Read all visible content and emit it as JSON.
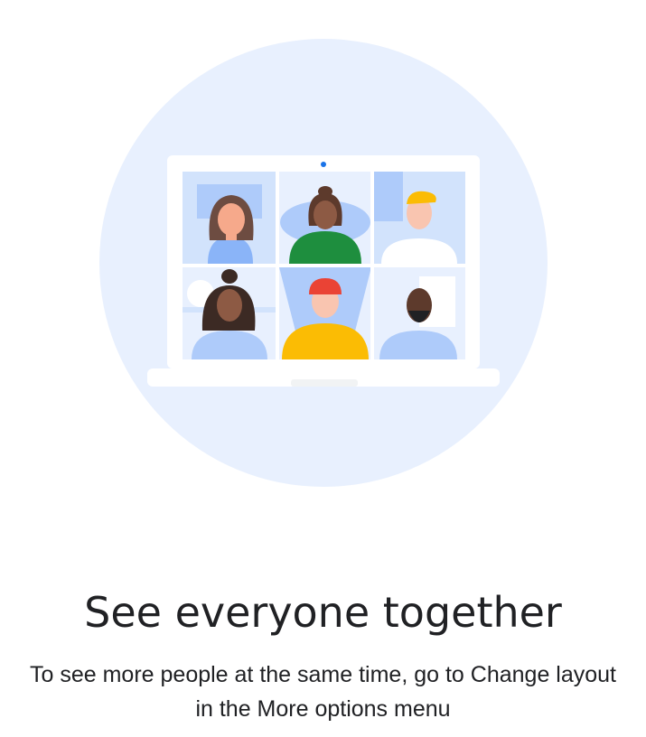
{
  "promo": {
    "title": "See everyone together",
    "description": "To see more people at the same time, go to Change layout in the More options menu"
  },
  "illustration": {
    "icon": "video-call-grid-illustration",
    "participants": [
      "participant-1",
      "participant-2",
      "participant-3",
      "participant-4",
      "participant-5",
      "participant-6"
    ]
  },
  "colors": {
    "circle_bg": "#e8f0fe",
    "tile_blue": "#aecbfa",
    "text": "#202124"
  }
}
